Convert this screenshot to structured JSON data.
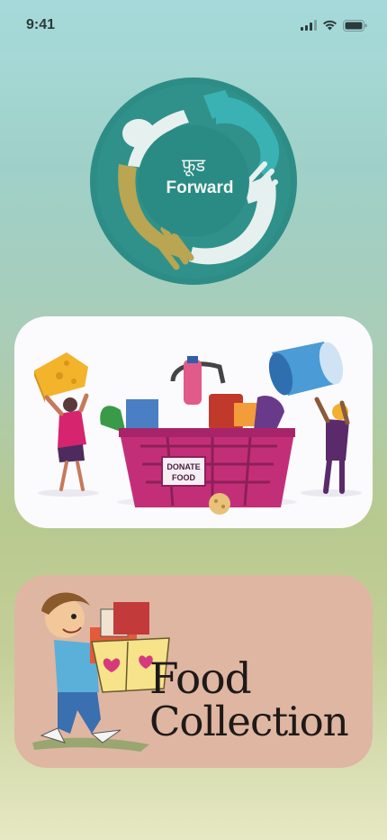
{
  "status_bar": {
    "time": "9:41",
    "icons": [
      "cellular-signal-icon",
      "wifi-icon",
      "battery-icon"
    ]
  },
  "logo": {
    "devanagari_text": "फ़ूड",
    "brand_text": "Forward"
  },
  "donate_card": {
    "label_line1": "DONATE",
    "label_line2": "FOOD"
  },
  "collection_card": {
    "line1": "Food",
    "line2": "Collection"
  },
  "colors": {
    "logo_ring": "#2f8f86",
    "logo_center": "#2a8b85",
    "basket": "#c22f78",
    "card_collect_bg": "#dfb6a2"
  }
}
